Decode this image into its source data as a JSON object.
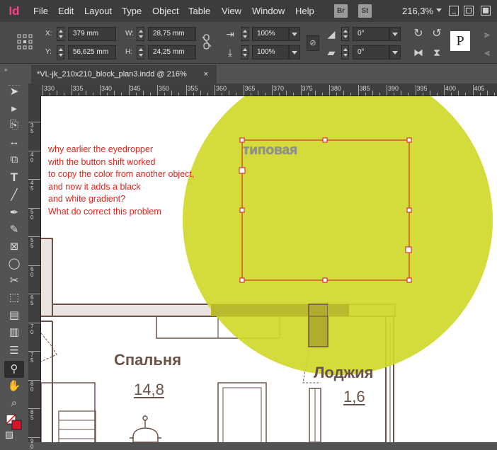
{
  "app": {
    "logo": "Id"
  },
  "menu": [
    "File",
    "Edit",
    "Layout",
    "Type",
    "Object",
    "Table",
    "View",
    "Window",
    "Help"
  ],
  "badges": {
    "bridge": "Br",
    "stock": "St"
  },
  "zoom": "216,3%",
  "control": {
    "x_label": "X:",
    "x_value": "379 mm",
    "y_label": "Y:",
    "y_value": "56,625 mm",
    "w_label": "W:",
    "w_value": "28,75 mm",
    "h_label": "H:",
    "h_value": "24,25 mm",
    "scale_x": "100%",
    "scale_y": "100%",
    "rotate": "0°",
    "shear": "0°"
  },
  "document_tab": {
    "title": "*VL-jk_210x210_block_plan3.indd @ 216%",
    "close": "×"
  },
  "ruler": {
    "horizontal": [
      "330",
      "335",
      "340",
      "345",
      "350",
      "355",
      "360",
      "365",
      "370",
      "375",
      "380",
      "385",
      "390",
      "395",
      "400",
      "405"
    ],
    "vertical": [
      "3\n5",
      "4\n0",
      "4\n5",
      "5\n0",
      "5\n5",
      "6\n0",
      "6\n5",
      "7\n0",
      "7\n5",
      "8\n0",
      "8\n5",
      "9\n0"
    ]
  },
  "annotation": [
    "why earlier the eyedropper",
    "with the button shift worked",
    "to copy the color from another object,",
    "and now it adds a black",
    "and white gradient?",
    "What do correct this problem"
  ],
  "frame_text": "типовая",
  "plan": {
    "room1": "Спальня",
    "room1_area": "14,8",
    "room2": "Лоджия",
    "room2_area": "1,6"
  },
  "colors": {
    "circle": "#cfd92a",
    "selection": "#d3162a",
    "annotation": "#e0251c",
    "plan_text": "#6b5248",
    "logo": "#ff3d8b"
  }
}
